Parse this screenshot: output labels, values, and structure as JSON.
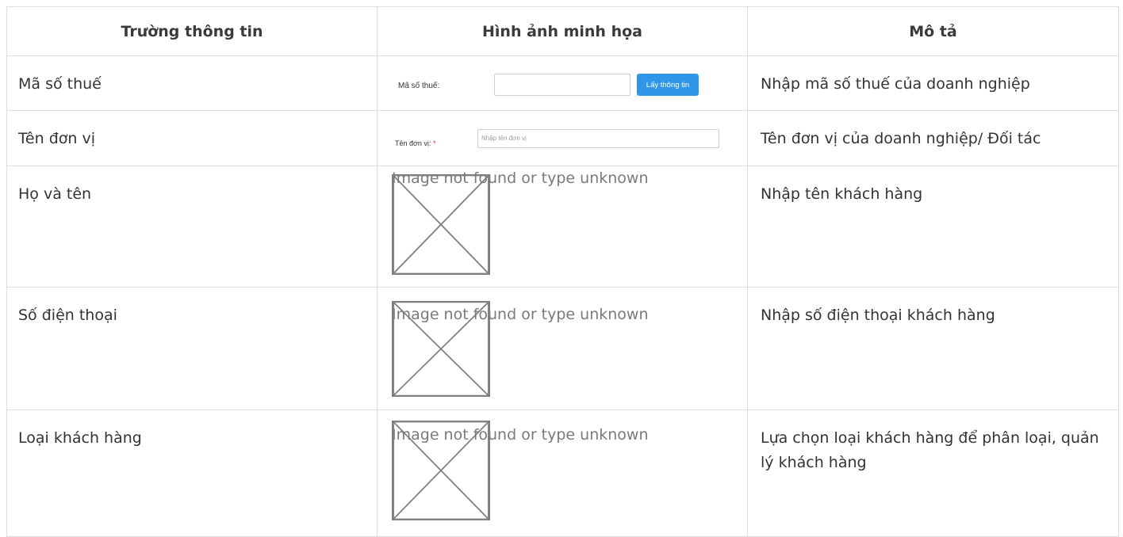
{
  "table": {
    "headers": [
      "Trường thông tin",
      "Hình ảnh minh họa",
      "Mô tả"
    ],
    "rows": [
      {
        "field": "Mã số thuế",
        "illustration": {
          "label": "Mã số thuế:",
          "button": "Lấy thông tin"
        },
        "description": "Nhập mã số thuế của doanh nghiệp"
      },
      {
        "field": "Tên đơn vị",
        "illustration": {
          "label": "Tên đơn vị:",
          "required_mark": "*",
          "placeholder": "Nhập tên đơn vị"
        },
        "description": "Tên đơn vị của doanh nghiệp/ Đối tác"
      },
      {
        "field": "Họ và tên",
        "illustration": {
          "broken_image_text": "Image not found or type unknown"
        },
        "description": "Nhập tên khách hàng"
      },
      {
        "field": "Số điện thoại",
        "illustration": {
          "broken_image_text": "Image not found or type unknown"
        },
        "description": "Nhập số điện thoại khách hàng"
      },
      {
        "field": "Loại khách hàng",
        "illustration": {
          "broken_image_text": "Image not found or type unknown"
        },
        "description": "Lựa chọn loại khách hàng để phân loại, quản lý khách hàng"
      }
    ]
  }
}
